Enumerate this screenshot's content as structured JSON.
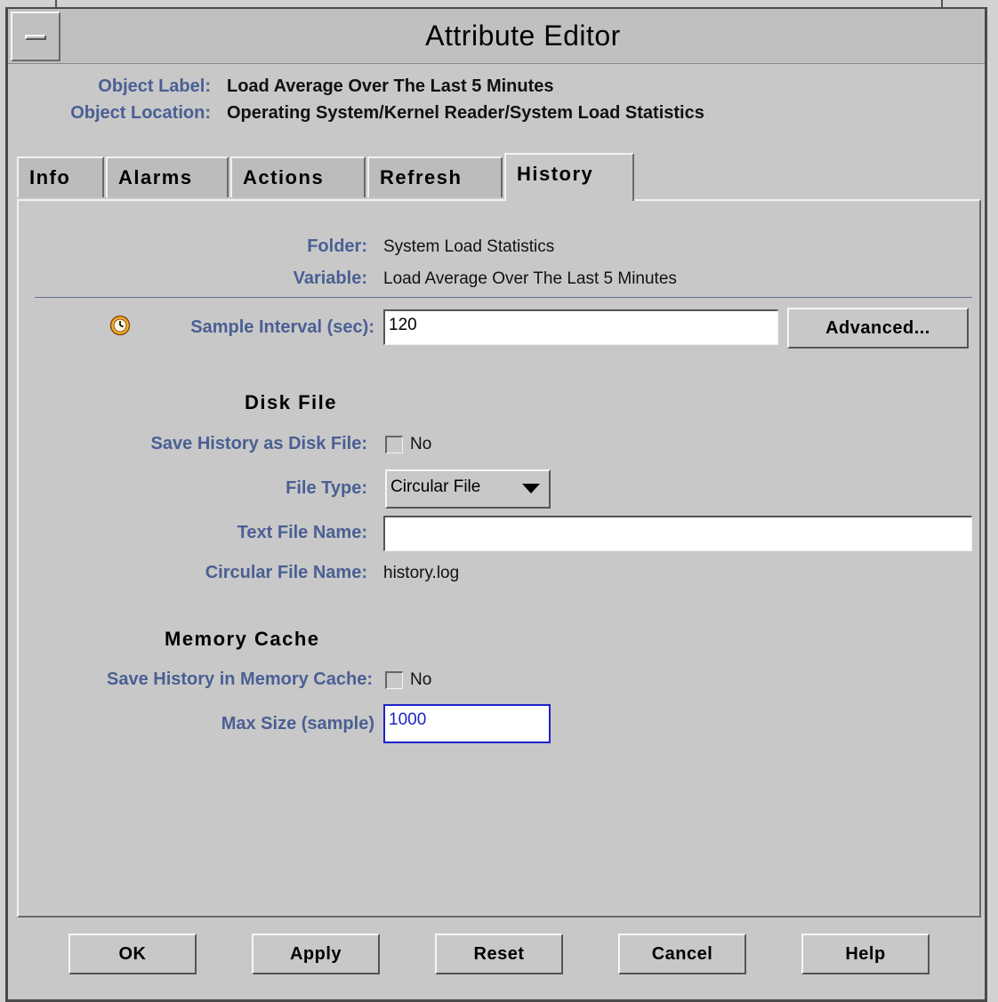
{
  "window": {
    "title": "Attribute Editor"
  },
  "object": {
    "label_key": "Object Label:",
    "label_value": "Load Average Over The Last 5 Minutes",
    "location_key": "Object Location:",
    "location_value": "Operating System/Kernel Reader/System Load Statistics"
  },
  "tabs": [
    {
      "label": "Info"
    },
    {
      "label": "Alarms"
    },
    {
      "label": "Actions"
    },
    {
      "label": "Refresh"
    },
    {
      "label": "History"
    }
  ],
  "active_tab": "History",
  "history": {
    "folder_label": "Folder:",
    "folder_value": "System Load Statistics",
    "variable_label": "Variable:",
    "variable_value": "Load Average Over The Last 5 Minutes",
    "sample_interval_label": "Sample Interval (sec):",
    "sample_interval_value": "120",
    "advanced_label": "Advanced...",
    "disk_file_heading": "Disk File",
    "save_disk_label": "Save History as Disk File:",
    "save_disk_value": "No",
    "file_type_label": "File Type:",
    "file_type_value": "Circular File",
    "text_file_label": "Text File Name:",
    "text_file_value": "",
    "circular_file_label": "Circular File Name:",
    "circular_file_value": "history.log",
    "memory_cache_heading": "Memory Cache",
    "save_memory_label": "Save History in Memory Cache:",
    "save_memory_value": "No",
    "max_size_label": "Max Size (sample)",
    "max_size_value": "1000"
  },
  "buttons": {
    "ok": "OK",
    "apply": "Apply",
    "reset": "Reset",
    "cancel": "Cancel",
    "help": "Help"
  },
  "colors": {
    "label_blue": "#4a5f94",
    "focus_blue": "#1c22c8",
    "window_gray": "#c8c8c8"
  }
}
